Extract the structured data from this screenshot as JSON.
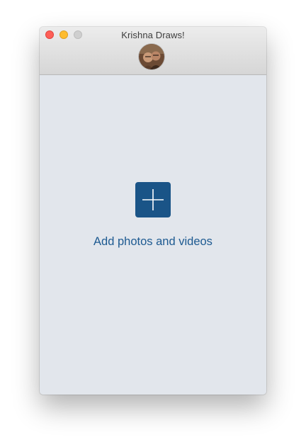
{
  "window": {
    "title": "Krishna Draws!"
  },
  "avatar": {
    "icon": "profile-photo"
  },
  "main": {
    "add_icon": "plus-icon",
    "add_label": "Add photos and videos"
  },
  "colors": {
    "accent": "#1a5487",
    "link_text": "#1d5a91",
    "content_background": "#e2e6ec",
    "close": "#fe5f57",
    "minimize": "#febc2e",
    "zoom_inactive": "#cfcfcf"
  }
}
